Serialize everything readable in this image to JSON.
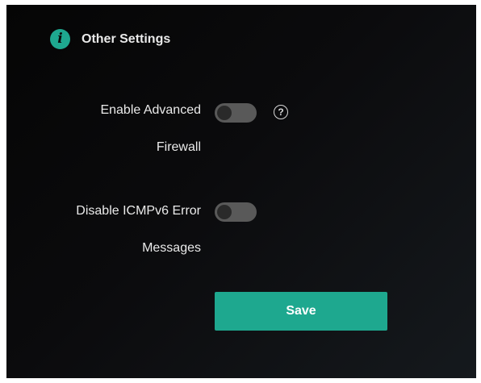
{
  "header": {
    "icon": "info-icon",
    "icon_glyph": "i",
    "title": "Other Settings"
  },
  "settings": [
    {
      "label_line1": "Enable Advanced",
      "label_line2": "Firewall",
      "enabled": false,
      "help_icon": "question-circle-icon",
      "help_glyph": "?"
    },
    {
      "label_line1": "Disable ICMPv6 Error",
      "label_line2": "Messages",
      "enabled": false
    }
  ],
  "save_label": "Save",
  "colors": {
    "accent": "#1ea88f",
    "toggle_off": "#595959"
  }
}
